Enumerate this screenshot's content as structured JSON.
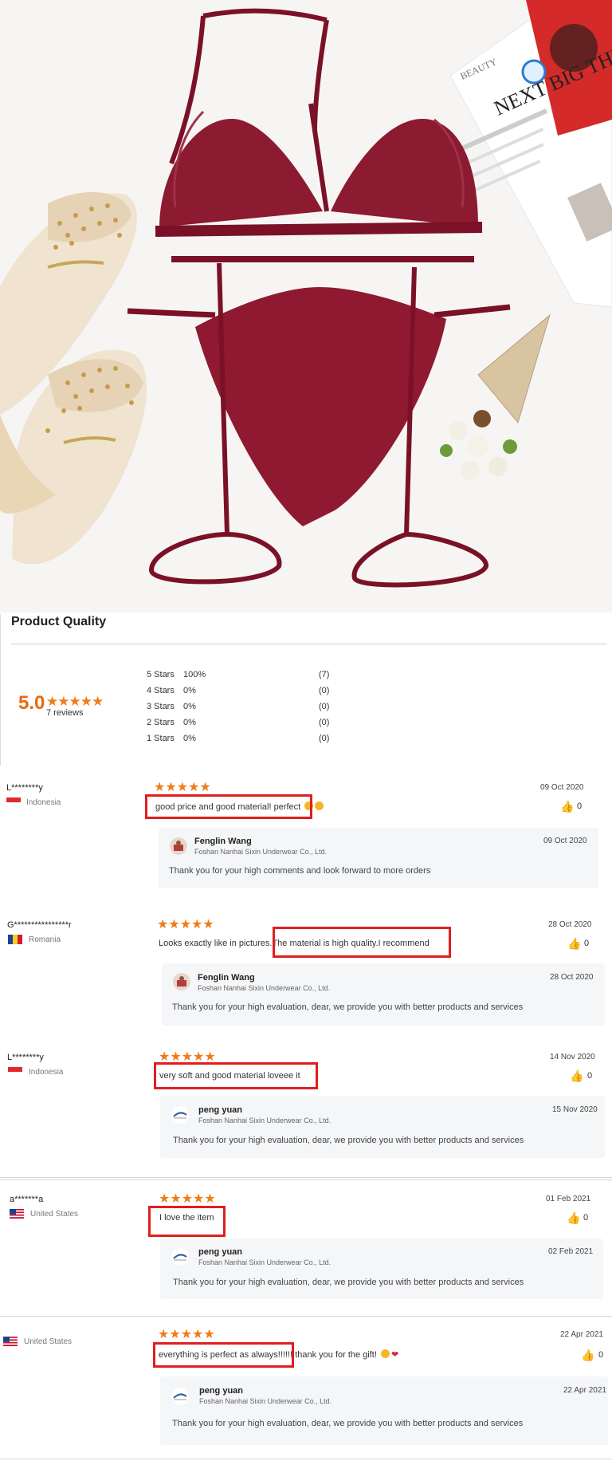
{
  "product_quality": {
    "title": "Product Quality",
    "average": "5.0",
    "stars": "★★★★★",
    "review_count": "7 reviews",
    "distribution": [
      {
        "label": "5  Stars",
        "percent": "100%",
        "count": "(7)"
      },
      {
        "label": "4  Stars",
        "percent": "0%",
        "count": "(0)"
      },
      {
        "label": "3  Stars",
        "percent": "0%",
        "count": "(0)"
      },
      {
        "label": "2  Stars",
        "percent": "0%",
        "count": "(0)"
      },
      {
        "label": "1  Stars",
        "percent": "0%",
        "count": "(0)"
      }
    ]
  },
  "photo": {
    "magazine_brand": "BEAUTY",
    "magazine_headline": "NEXT BIG THING"
  },
  "reviews": [
    {
      "name": "L********y",
      "country": "Indonesia",
      "stars": "★★★★★",
      "date": "09 Oct 2020",
      "text": "good price and good material! perfect",
      "likes": "0",
      "reply": {
        "name": "Fenglin Wang",
        "company": "Foshan Nanhai Sixin Underwear Co., Ltd.",
        "date": "09 Oct 2020",
        "text": "Thank you for your high comments and look forward to more orders"
      }
    },
    {
      "name": "G****************r",
      "country": "Romania",
      "stars": "★★★★★",
      "date": "28 Oct 2020",
      "text_prefix": "Looks exactly like in pictures.",
      "text": "The material is high quality.I recommend",
      "likes": "0",
      "reply": {
        "name": "Fenglin Wang",
        "company": "Foshan Nanhai Sixin Underwear Co., Ltd.",
        "date": "28 Oct 2020",
        "text": "Thank you for your high evaluation, dear, we provide you with better products and services"
      }
    },
    {
      "name": "L********y",
      "country": "Indonesia",
      "stars": "★★★★★",
      "date": "14 Nov 2020",
      "text": "very soft and good material loveee it",
      "likes": "0",
      "reply": {
        "name": "peng yuan",
        "company": "Foshan Nanhai Sixin Underwear Co., Ltd.",
        "date": "15 Nov 2020",
        "text": "Thank you for your high evaluation, dear, we provide you with better products and services"
      }
    },
    {
      "name": "a*******a",
      "country": "United States",
      "stars": "★★★★★",
      "date": "01 Feb 2021",
      "text": "I love the item",
      "likes": "0",
      "reply": {
        "name": "peng yuan",
        "company": "Foshan Nanhai Sixin Underwear Co., Ltd.",
        "date": "02 Feb 2021",
        "text": "Thank you for your high evaluation, dear, we provide you with better products and services"
      }
    },
    {
      "name": "",
      "country": "United States",
      "stars": "★★★★★",
      "date": "22 Apr 2021",
      "text": "everything is perfect as always!",
      "text_suffix": "!!!!! thank you for the gift!",
      "likes": "0",
      "reply": {
        "name": "peng yuan",
        "company": "Foshan Nanhai Sixin Underwear Co., Ltd.",
        "date": "22 Apr 2021",
        "text": "Thank you for your high evaluation, dear, we provide you with better products and services"
      }
    }
  ],
  "colors": {
    "star": "#f07c15",
    "score": "#e9690c",
    "highlight_box": "#e01e1e",
    "reply_bg": "#f5f6f8",
    "product": "#7a1127"
  }
}
